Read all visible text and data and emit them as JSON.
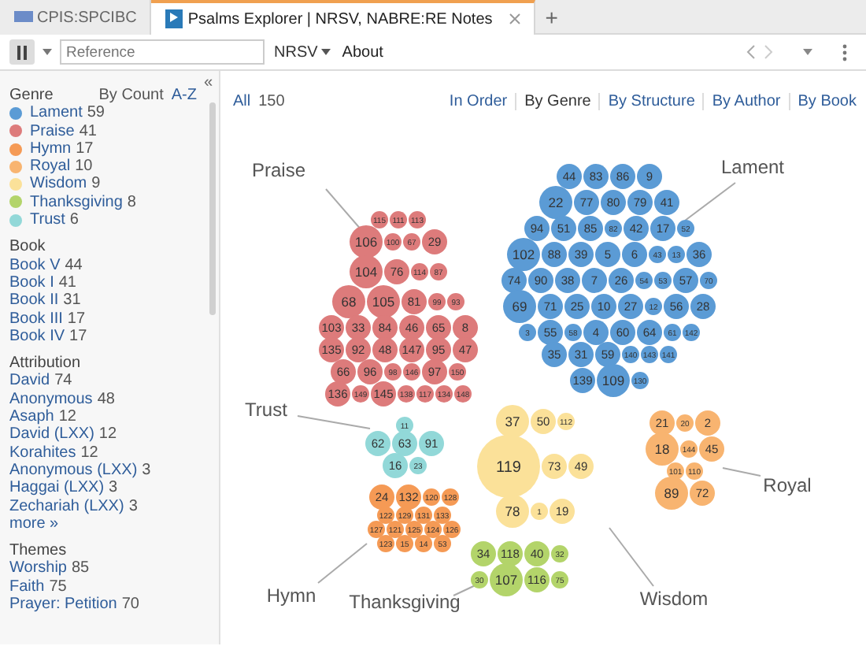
{
  "tabs": [
    {
      "label": "CPIS:SPCIBC",
      "selected": false
    },
    {
      "label": "Psalms Explorer | NRSV, NABRE:RE Notes",
      "selected": true
    }
  ],
  "new_tab": "+",
  "toolbar": {
    "placeholder": "Reference",
    "version": "NRSV",
    "about": "About"
  },
  "sidebar": {
    "collapse": "«",
    "sections": [
      {
        "title": "Genre",
        "sort": [
          {
            "label": "By Count",
            "selected": true
          },
          {
            "label": "A-Z",
            "selected": false
          }
        ],
        "items": [
          {
            "label": "Lament",
            "count": "59",
            "color": "#5b9bd5"
          },
          {
            "label": "Praise",
            "count": "41",
            "color": "#dd7b7b"
          },
          {
            "label": "Hymn",
            "count": "17",
            "color": "#f59a55"
          },
          {
            "label": "Royal",
            "count": "10",
            "color": "#f8b470"
          },
          {
            "label": "Wisdom",
            "count": "9",
            "color": "#fbe199"
          },
          {
            "label": "Thanksgiving",
            "count": "8",
            "color": "#b3d46a"
          },
          {
            "label": "Trust",
            "count": "6",
            "color": "#92d8d8"
          }
        ]
      },
      {
        "title": "Book",
        "items": [
          {
            "label": "Book V",
            "count": "44"
          },
          {
            "label": "Book I",
            "count": "41"
          },
          {
            "label": "Book II",
            "count": "31"
          },
          {
            "label": "Book III",
            "count": "17"
          },
          {
            "label": "Book IV",
            "count": "17"
          }
        ]
      },
      {
        "title": "Attribution",
        "items": [
          {
            "label": "David",
            "count": "74"
          },
          {
            "label": "Anonymous",
            "count": "48"
          },
          {
            "label": "Asaph",
            "count": "12"
          },
          {
            "label": "David (LXX)",
            "count": "12"
          },
          {
            "label": "Korahites",
            "count": "12"
          },
          {
            "label": "Anonymous (LXX)",
            "count": "3"
          },
          {
            "label": "Haggai (LXX)",
            "count": "3"
          },
          {
            "label": "Zechariah (LXX)",
            "count": "3"
          }
        ],
        "more": "more »"
      },
      {
        "title": "Themes",
        "items": [
          {
            "label": "Worship",
            "count": "85"
          },
          {
            "label": "Faith",
            "count": "75"
          },
          {
            "label": "Prayer: Petition",
            "count": "70"
          }
        ]
      }
    ]
  },
  "main": {
    "all": "All",
    "total": "150",
    "views": [
      {
        "label": "In Order",
        "selected": false
      },
      {
        "label": "By Genre",
        "selected": true
      },
      {
        "label": "By Structure",
        "selected": false
      },
      {
        "label": "By Author",
        "selected": false
      },
      {
        "label": "By Book",
        "selected": false
      }
    ],
    "clusters": [
      {
        "name": "Praise",
        "color": "#dd7b7b",
        "rows": [
          [
            {
              "label": "115",
              "kind": "s"
            },
            {
              "label": "111",
              "kind": "s"
            },
            {
              "label": "113",
              "kind": "s"
            }
          ],
          [
            {
              "label": "106",
              "kind": "l"
            },
            {
              "label": "100",
              "kind": "s"
            },
            {
              "label": "67",
              "kind": "s"
            },
            {
              "label": "29",
              "kind": "m"
            }
          ],
          [
            {
              "label": "104",
              "kind": "l"
            },
            {
              "label": "76",
              "kind": "m"
            },
            {
              "label": "114",
              "kind": "s"
            },
            {
              "label": "87",
              "kind": "s"
            }
          ],
          [
            {
              "label": "68",
              "kind": "l"
            },
            {
              "label": "105",
              "kind": "l"
            },
            {
              "label": "81",
              "kind": "m"
            },
            {
              "label": "99",
              "kind": "s"
            },
            {
              "label": "93",
              "kind": "s"
            }
          ],
          [
            {
              "label": "103",
              "kind": "m"
            },
            {
              "label": "33",
              "kind": "m"
            },
            {
              "label": "84",
              "kind": "m"
            },
            {
              "label": "46",
              "kind": "m"
            },
            {
              "label": "65",
              "kind": "m"
            },
            {
              "label": "8",
              "kind": "m"
            }
          ],
          [
            {
              "label": "135",
              "kind": "m"
            },
            {
              "label": "92",
              "kind": "m"
            },
            {
              "label": "48",
              "kind": "m"
            },
            {
              "label": "147",
              "kind": "m"
            },
            {
              "label": "95",
              "kind": "m"
            },
            {
              "label": "47",
              "kind": "m"
            }
          ],
          [
            {
              "label": "66",
              "kind": "m"
            },
            {
              "label": "96",
              "kind": "m"
            },
            {
              "label": "98",
              "kind": "s"
            },
            {
              "label": "146",
              "kind": "s"
            },
            {
              "label": "97",
              "kind": "m"
            },
            {
              "label": "150",
              "kind": "s"
            }
          ],
          [
            {
              "label": "136",
              "kind": "m"
            },
            {
              "label": "149",
              "kind": "s"
            },
            {
              "label": "145",
              "kind": "m"
            },
            {
              "label": "138",
              "kind": "s"
            },
            {
              "label": "117",
              "kind": "s"
            },
            {
              "label": "134",
              "kind": "s"
            },
            {
              "label": "148",
              "kind": "s"
            }
          ]
        ]
      },
      {
        "name": "Lament",
        "color": "#5b9bd5",
        "rows": [
          [
            {
              "label": "44",
              "kind": "m"
            },
            {
              "label": "83",
              "kind": "m"
            },
            {
              "label": "86",
              "kind": "m"
            },
            {
              "label": "9",
              "kind": "m"
            }
          ],
          [
            {
              "label": "22",
              "kind": "l"
            },
            {
              "label": "77",
              "kind": "m"
            },
            {
              "label": "80",
              "kind": "m"
            },
            {
              "label": "79",
              "kind": "m"
            },
            {
              "label": "41",
              "kind": "m"
            }
          ],
          [
            {
              "label": "94",
              "kind": "m"
            },
            {
              "label": "51",
              "kind": "m"
            },
            {
              "label": "85",
              "kind": "m"
            },
            {
              "label": "82",
              "kind": "s"
            },
            {
              "label": "42",
              "kind": "m"
            },
            {
              "label": "17",
              "kind": "m"
            },
            {
              "label": "52",
              "kind": "s"
            }
          ],
          [
            {
              "label": "102",
              "kind": "l"
            },
            {
              "label": "88",
              "kind": "m"
            },
            {
              "label": "39",
              "kind": "m"
            },
            {
              "label": "5",
              "kind": "m"
            },
            {
              "label": "6",
              "kind": "m"
            },
            {
              "label": "43",
              "kind": "s"
            },
            {
              "label": "13",
              "kind": "s"
            },
            {
              "label": "36",
              "kind": "m"
            }
          ],
          [
            {
              "label": "74",
              "kind": "m"
            },
            {
              "label": "90",
              "kind": "m"
            },
            {
              "label": "38",
              "kind": "m"
            },
            {
              "label": "7",
              "kind": "m"
            },
            {
              "label": "26",
              "kind": "m"
            },
            {
              "label": "54",
              "kind": "s"
            },
            {
              "label": "53",
              "kind": "s"
            },
            {
              "label": "57",
              "kind": "m"
            },
            {
              "label": "70",
              "kind": "s"
            }
          ],
          [
            {
              "label": "69",
              "kind": "l"
            },
            {
              "label": "71",
              "kind": "m"
            },
            {
              "label": "25",
              "kind": "m"
            },
            {
              "label": "10",
              "kind": "m"
            },
            {
              "label": "27",
              "kind": "m"
            },
            {
              "label": "12",
              "kind": "s"
            },
            {
              "label": "56",
              "kind": "m"
            },
            {
              "label": "28",
              "kind": "m"
            }
          ],
          [
            {
              "label": "3",
              "kind": "s"
            },
            {
              "label": "55",
              "kind": "m"
            },
            {
              "label": "58",
              "kind": "s"
            },
            {
              "label": "4",
              "kind": "m"
            },
            {
              "label": "60",
              "kind": "m"
            },
            {
              "label": "64",
              "kind": "m"
            },
            {
              "label": "61",
              "kind": "s"
            },
            {
              "label": "142",
              "kind": "s"
            }
          ],
          [
            {
              "label": "35",
              "kind": "m"
            },
            {
              "label": "31",
              "kind": "m"
            },
            {
              "label": "59",
              "kind": "m"
            },
            {
              "label": "140",
              "kind": "s"
            },
            {
              "label": "143",
              "kind": "s"
            },
            {
              "label": "141",
              "kind": "s"
            }
          ],
          [
            {
              "label": "139",
              "kind": "m"
            },
            {
              "label": "109",
              "kind": "l"
            },
            {
              "label": "130",
              "kind": "s"
            }
          ]
        ]
      },
      {
        "name": "Trust",
        "color": "#92d8d8",
        "rows": [
          [
            {
              "label": "11",
              "kind": "s"
            }
          ],
          [
            {
              "label": "62",
              "kind": "m"
            },
            {
              "label": "63",
              "kind": "m"
            },
            {
              "label": "91",
              "kind": "m"
            }
          ],
          [
            {
              "label": "16",
              "kind": "m"
            },
            {
              "label": "23",
              "kind": "s"
            }
          ]
        ]
      },
      {
        "name": "Royal",
        "color": "#f8b470",
        "rows": [
          [
            {
              "label": "21",
              "kind": "m"
            },
            {
              "label": "20",
              "kind": "s"
            },
            {
              "label": "2",
              "kind": "m"
            }
          ],
          [
            {
              "label": "18",
              "kind": "l"
            },
            {
              "label": "144",
              "kind": "s"
            },
            {
              "label": "45",
              "kind": "m"
            }
          ],
          [
            {
              "label": "101",
              "kind": "s"
            },
            {
              "label": "110",
              "kind": "s"
            }
          ],
          [
            {
              "label": "89",
              "kind": "l"
            },
            {
              "label": "72",
              "kind": "m"
            }
          ]
        ]
      },
      {
        "name": "Hymn",
        "color": "#f59a55",
        "rows": [
          [
            {
              "label": "24",
              "kind": "m"
            },
            {
              "label": "132",
              "kind": "m"
            },
            {
              "label": "120",
              "kind": "s"
            },
            {
              "label": "128",
              "kind": "s"
            }
          ],
          [
            {
              "label": "122",
              "kind": "s"
            },
            {
              "label": "129",
              "kind": "s"
            },
            {
              "label": "131",
              "kind": "s"
            },
            {
              "label": "133",
              "kind": "s"
            }
          ],
          [
            {
              "label": "127",
              "kind": "s"
            },
            {
              "label": "121",
              "kind": "s"
            },
            {
              "label": "125",
              "kind": "s"
            },
            {
              "label": "124",
              "kind": "s"
            },
            {
              "label": "126",
              "kind": "s"
            }
          ],
          [
            {
              "label": "123",
              "kind": "s"
            },
            {
              "label": "15",
              "kind": "s"
            },
            {
              "label": "14",
              "kind": "s"
            },
            {
              "label": "53",
              "kind": "s"
            }
          ]
        ]
      },
      {
        "name": "Thanksgiving",
        "color": "#b3d46a",
        "rows": [
          [
            {
              "label": "34",
              "kind": "m"
            },
            {
              "label": "118",
              "kind": "m"
            },
            {
              "label": "40",
              "kind": "m"
            },
            {
              "label": "32",
              "kind": "s"
            }
          ],
          [
            {
              "label": "30",
              "kind": "s"
            },
            {
              "label": "107",
              "kind": "l"
            },
            {
              "label": "116",
              "kind": "m"
            },
            {
              "label": "75",
              "kind": "s"
            }
          ]
        ]
      },
      {
        "name": "Wisdom",
        "color": "#fbe199",
        "rows": [
          [
            {
              "label": "37",
              "kind": "l"
            },
            {
              "label": "50",
              "kind": "m"
            },
            {
              "label": "112",
              "kind": "s"
            }
          ],
          [
            {
              "label": "119",
              "kind": "xl"
            },
            {
              "label": "73",
              "kind": "m"
            },
            {
              "label": "49",
              "kind": "m"
            }
          ],
          [
            {
              "label": "78",
              "kind": "l"
            },
            {
              "label": "1",
              "kind": "s"
            },
            {
              "label": "19",
              "kind": "m"
            }
          ]
        ]
      }
    ]
  }
}
